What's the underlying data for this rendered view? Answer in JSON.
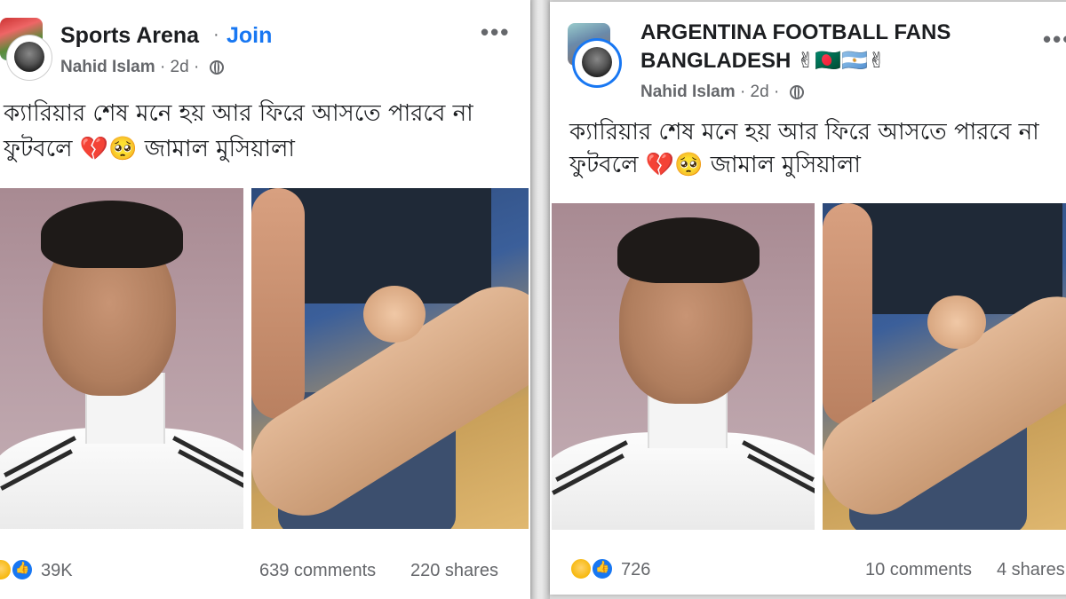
{
  "posts": [
    {
      "group_name": "Sports Arena",
      "join_label": "Join",
      "author": "Nahid Islam",
      "time": "2d",
      "text_line1": "ক্যারিয়ার শেষ মনে হয় আর ফিরে আসতে পারবে না",
      "text_line2": "ফুটবলে 💔🥺 জামাল মুসিয়ালা",
      "reaction_count": "39K",
      "comments": "639 comments",
      "shares": "220 shares"
    },
    {
      "group_name_line1": "ARGENTINA FOOTBALL FANS",
      "group_name_line2": "BANGLADESH ✌🇧🇩🇦🇷✌",
      "author": "Nahid Islam",
      "time": "2d",
      "text_line1": "ক্যারিয়ার শেষ মনে হয় আর ফিরে আসতে পারবে না",
      "text_line2": "ফুটবলে 💔🥺 জামাল মুসিয়ালা",
      "reaction_count": "726",
      "comments": "10 comments",
      "shares": "4 shares"
    }
  ],
  "icons": [
    "globe-icon",
    "more-options-icon",
    "sad-reaction-icon",
    "like-reaction-icon"
  ],
  "colors": {
    "join": "#1877f2",
    "meta": "#65676b",
    "text": "#1c1e21"
  }
}
